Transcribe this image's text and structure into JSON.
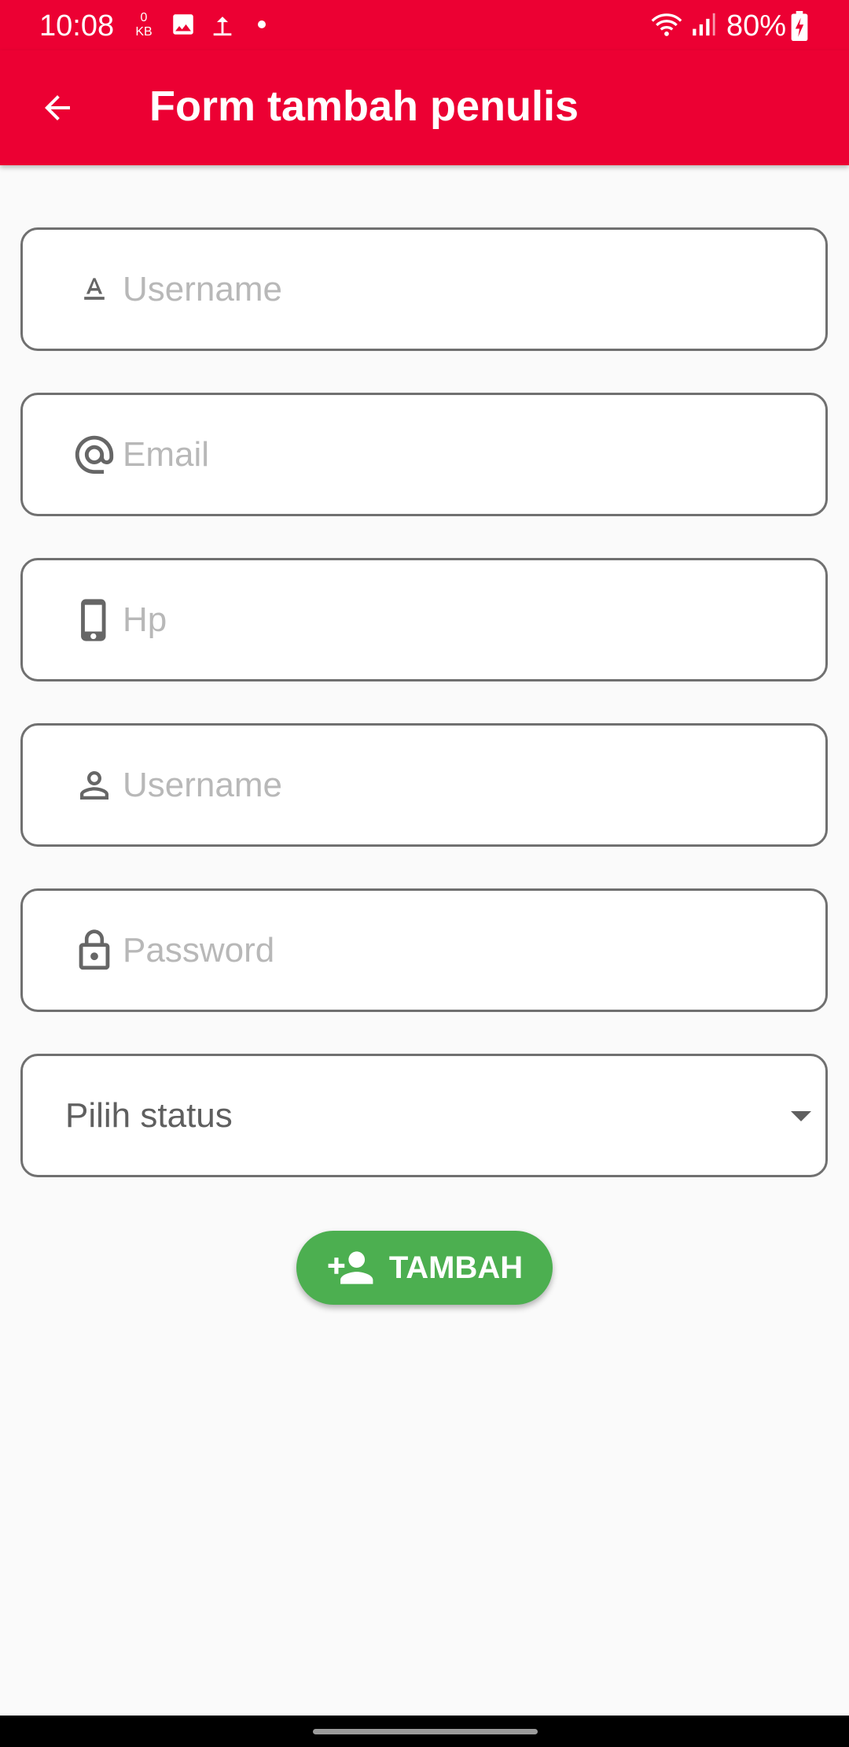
{
  "status_bar": {
    "time": "10:08",
    "data_counter_value": "0",
    "data_counter_unit": "KB",
    "battery_percent": "80%"
  },
  "app_bar": {
    "title": "Form tambah penulis",
    "back_icon": "arrow-back-icon",
    "color": "#ec0033"
  },
  "form": {
    "fields": [
      {
        "icon": "text-format-icon",
        "placeholder": "Username",
        "value": ""
      },
      {
        "icon": "at-sign-icon",
        "placeholder": "Email",
        "value": ""
      },
      {
        "icon": "phone-icon",
        "placeholder": "Hp",
        "value": ""
      },
      {
        "icon": "person-icon",
        "placeholder": "Username",
        "value": ""
      },
      {
        "icon": "lock-icon",
        "placeholder": "Password",
        "value": ""
      }
    ],
    "status_select": {
      "label": "Pilih status",
      "icon": "dropdown-arrow-icon"
    },
    "submit": {
      "label": "TAMBAH",
      "icon": "person-add-icon",
      "color": "#4caf50"
    }
  }
}
